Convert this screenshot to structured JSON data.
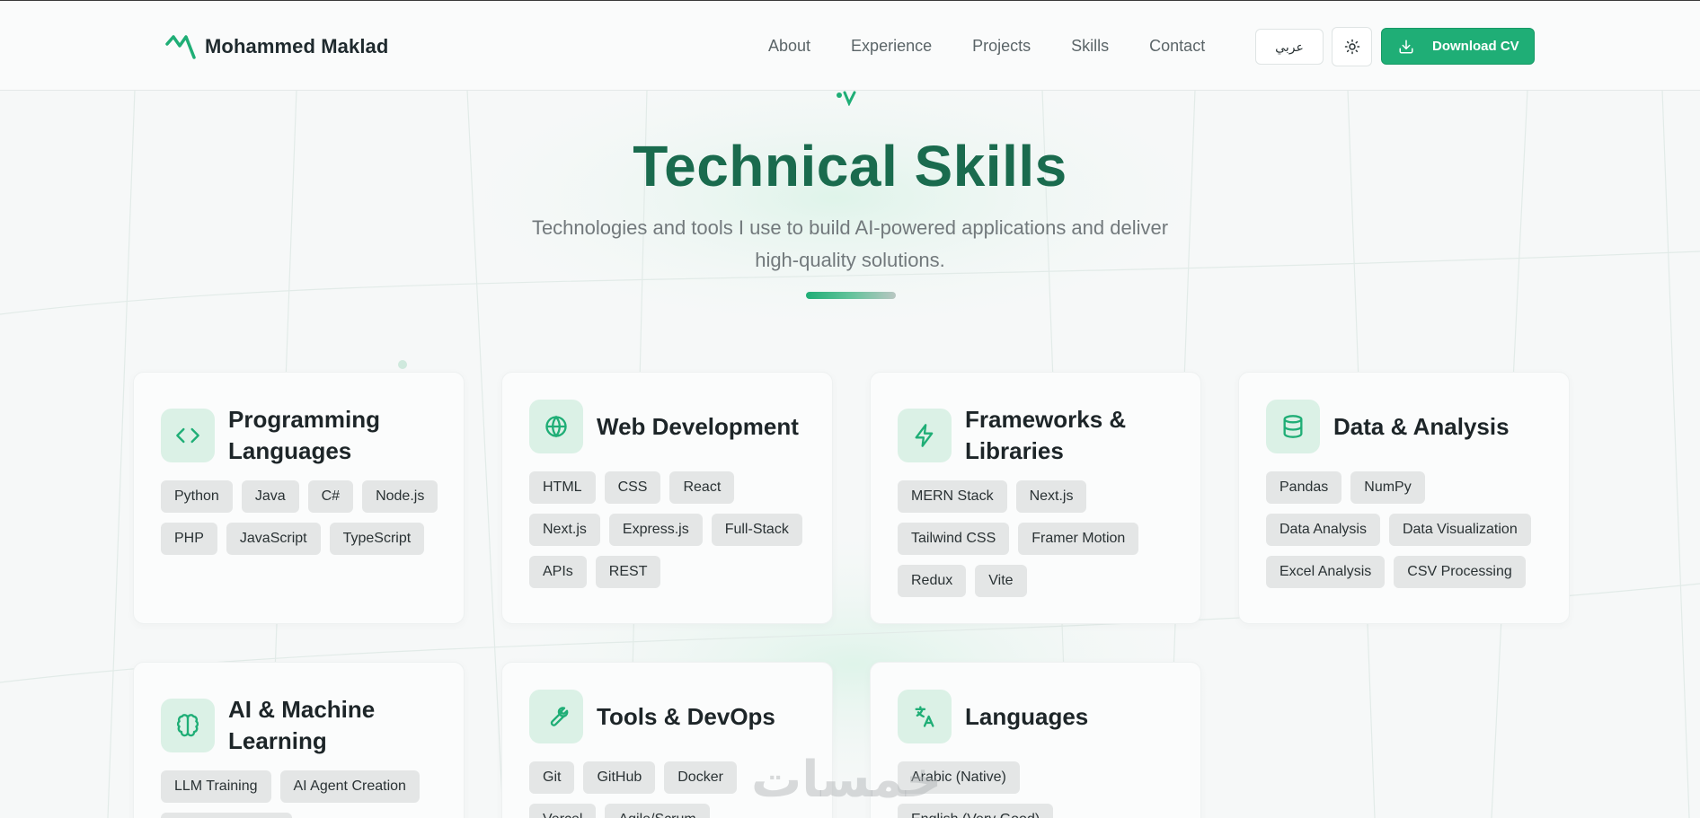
{
  "brand": {
    "name": "Mohammed Maklad"
  },
  "nav": {
    "links": [
      "About",
      "Experience",
      "Projects",
      "Skills",
      "Contact"
    ],
    "lang_label": "عربي",
    "cv_label": "Download CV"
  },
  "hero": {
    "title": "Technical Skills",
    "subtitle_line1": "Technologies and tools I use to build AI-powered applications and deliver",
    "subtitle_line2": "high-quality solutions."
  },
  "cards": [
    {
      "title_line1": "Programming",
      "title_line2": "Languages",
      "icon": "code-icon",
      "chips": [
        "Python",
        "Java",
        "C#",
        "Node.js",
        "PHP",
        "JavaScript",
        "TypeScript"
      ]
    },
    {
      "title_line1": "Web Development",
      "title_line2": "",
      "icon": "globe-icon",
      "chips": [
        "HTML",
        "CSS",
        "React",
        "Next.js",
        "Express.js",
        "Full-Stack",
        "APIs",
        "REST"
      ]
    },
    {
      "title_line1": "Frameworks &",
      "title_line2": "Libraries",
      "icon": "lightning-icon",
      "chips": [
        "MERN Stack",
        "Next.js",
        "Tailwind CSS",
        "Framer Motion",
        "Redux",
        "Vite"
      ]
    },
    {
      "title_line1": "Data & Analysis",
      "title_line2": "",
      "icon": "database-icon",
      "chips": [
        "Pandas",
        "NumPy",
        "Data Analysis",
        "Data Visualization",
        "Excel Analysis",
        "CSV Processing"
      ]
    },
    {
      "title_line1": "AI & Machine",
      "title_line2": "Learning",
      "icon": "brain-icon",
      "chips": [
        "LLM Training",
        "AI Agent Creation",
        ""
      ]
    },
    {
      "title_line1": "Tools & DevOps",
      "title_line2": "",
      "icon": "wrench-icon",
      "chips": [
        "Git",
        "GitHub",
        "Docker",
        "Vercel",
        "Agile/Scrum"
      ]
    },
    {
      "title_line1": "Languages",
      "title_line2": "",
      "icon": "translate-icon",
      "chips": [
        "Arabic (Native)",
        "English (Very Good)"
      ]
    }
  ],
  "watermark": "خمسات",
  "colors": {
    "accent": "#1fae76",
    "title_green": "#1a6b4e",
    "chip_bg": "#e4e6e6",
    "icon_bg": "#dbf1e6"
  }
}
